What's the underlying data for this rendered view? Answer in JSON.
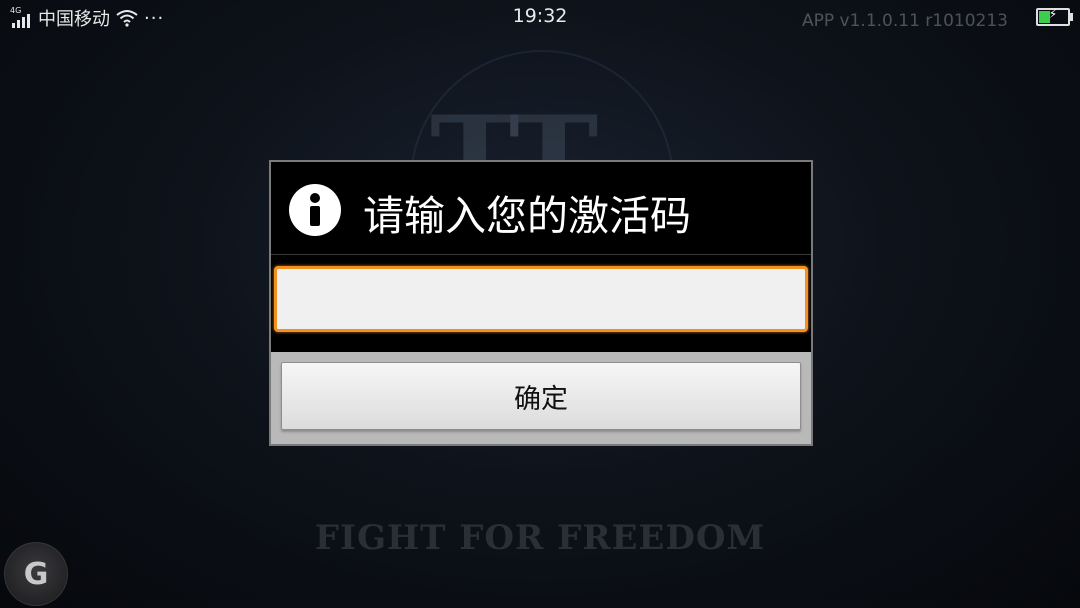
{
  "status_bar": {
    "network_type": "4G",
    "carrier": "中国移动",
    "more_indicator": "···",
    "time": "19:32",
    "app_version": "APP v1.1.0.11 r1010213",
    "battery_level": 0.4,
    "battery_color": "#3ccf4e"
  },
  "background": {
    "tagline": "FIGHT FOR FREEDOM"
  },
  "dialog": {
    "title": "请输入您的激活码",
    "icon": "info-icon",
    "input": {
      "value": "",
      "placeholder": ""
    },
    "confirm_label": "确定",
    "accent_color": "#f3901f"
  },
  "float_button": {
    "label": "G"
  }
}
